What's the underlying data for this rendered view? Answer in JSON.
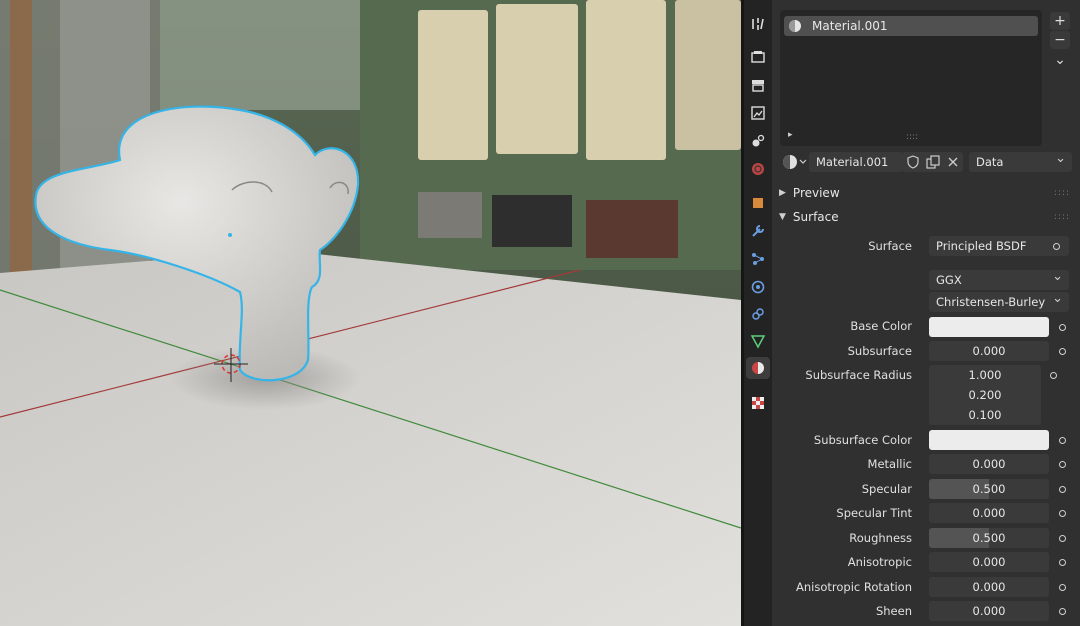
{
  "material_slots": {
    "items": [
      {
        "name": "Material.001"
      }
    ],
    "add_symbol": "+",
    "remove_symbol": "−",
    "more_symbol": "⌄",
    "expand_symbol": "▸",
    "grip": "::::"
  },
  "material_bar": {
    "name": "Material.001",
    "link_mode": "Data"
  },
  "panels": {
    "preview": "Preview",
    "surface": "Surface"
  },
  "surface": {
    "label": "Surface",
    "shader": "Principled BSDF",
    "distribution": "GGX",
    "subsurface_method": "Christensen-Burley",
    "rows": [
      {
        "label": "Base Color",
        "type": "color",
        "color": "#ececec"
      },
      {
        "label": "Subsurface",
        "value": "0.000"
      },
      {
        "label": "Subsurface Radius",
        "values": [
          "1.000",
          "0.200",
          "0.100"
        ]
      },
      {
        "label": "Subsurface Color",
        "type": "color",
        "color": "#ececec"
      },
      {
        "label": "Metallic",
        "value": "0.000"
      },
      {
        "label": "Specular",
        "value": "0.500",
        "fraction": 0.5
      },
      {
        "label": "Specular Tint",
        "value": "0.000"
      },
      {
        "label": "Roughness",
        "value": "0.500",
        "fraction": 0.5
      },
      {
        "label": "Anisotropic",
        "value": "0.000"
      },
      {
        "label": "Anisotropic Rotation",
        "value": "0.000"
      },
      {
        "label": "Sheen",
        "value": "0.000"
      }
    ]
  },
  "tab_icons": [
    "tool-icon",
    "render-icon",
    "output-icon",
    "view-layer-icon",
    "scene-icon",
    "world-icon",
    "object-icon",
    "modifier-icon",
    "particles-icon",
    "physics-icon",
    "constraints-icon",
    "object-data-icon",
    "material-icon",
    "texture-icon"
  ],
  "colors": {
    "selection_outline": "#35b4e8",
    "x_axis": "#a23a3a",
    "y_axis": "#3f8a3c",
    "panel_bg": "#303030",
    "field_bg": "#545454"
  }
}
